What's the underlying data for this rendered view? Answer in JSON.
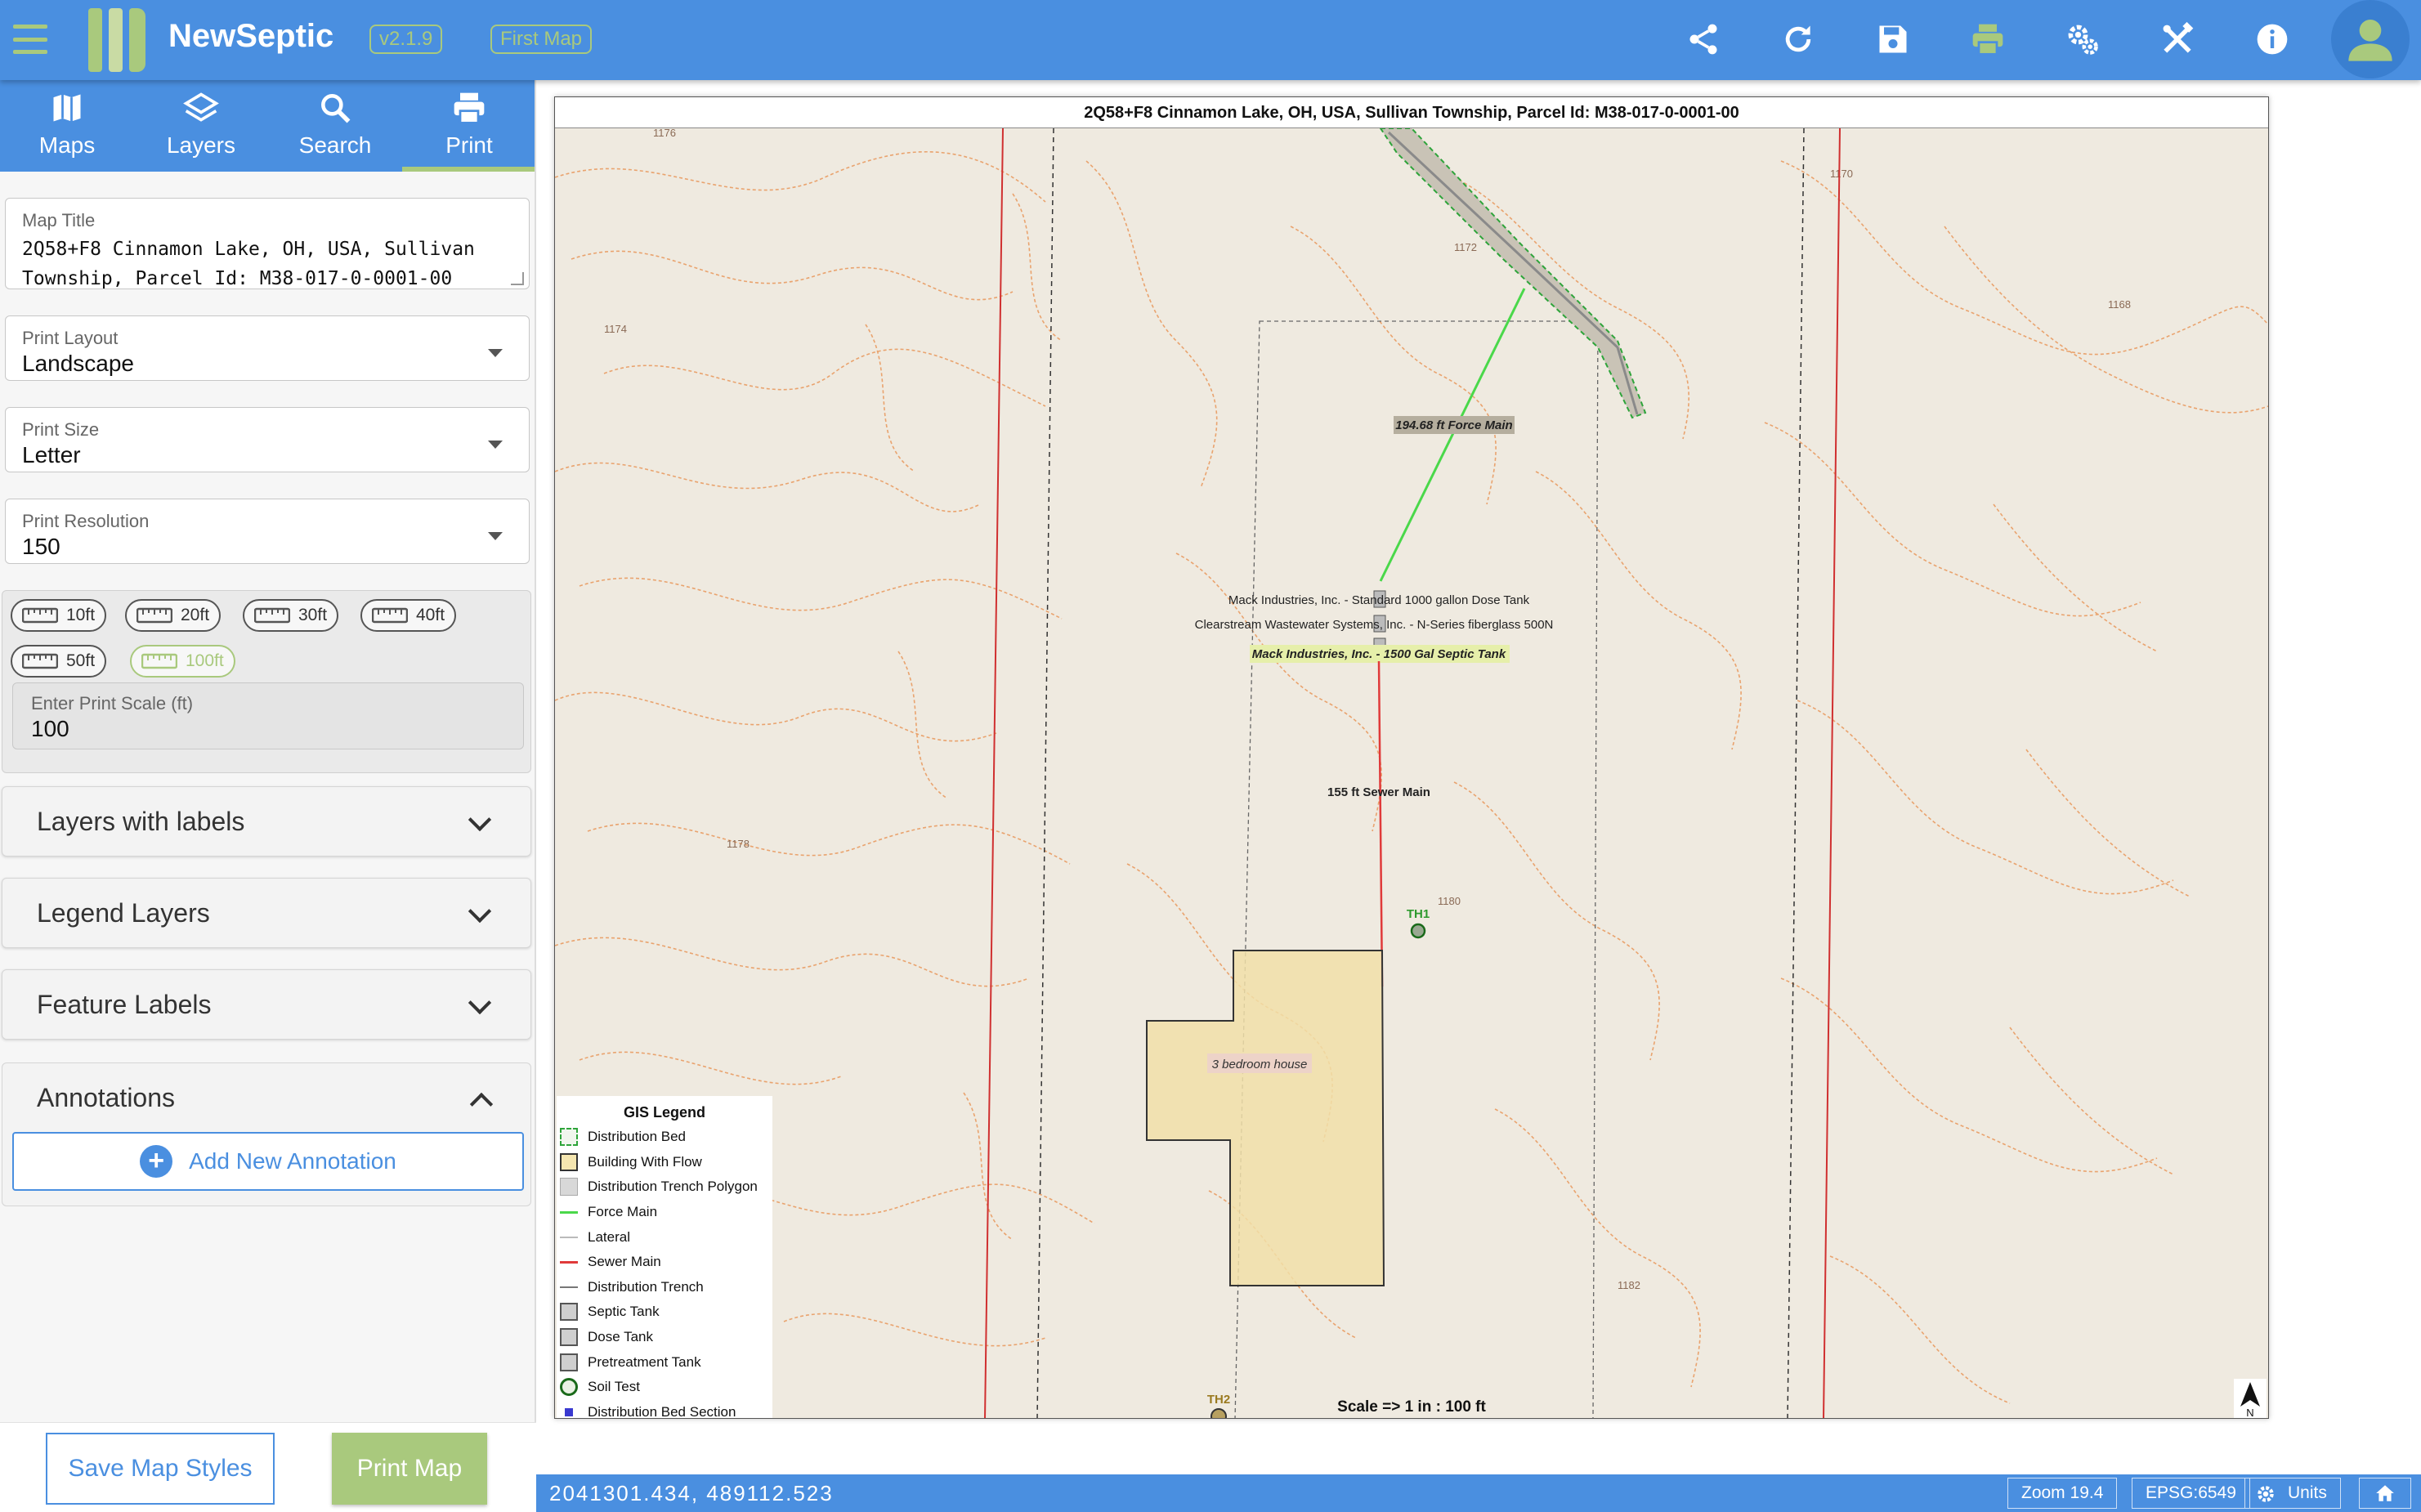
{
  "app": {
    "name": "NewSeptic",
    "version": "v2.1.9",
    "map_name": "First Map"
  },
  "toolbar": {
    "icons": [
      "share-icon",
      "refresh-icon",
      "save-icon",
      "print-icon",
      "settings-icon",
      "tools-icon",
      "info-icon",
      "user-icon"
    ],
    "active_color": "#a9c97d",
    "bar_color": "#4a8fe0"
  },
  "tabs": [
    {
      "label": "Maps",
      "icon": "map-icon"
    },
    {
      "label": "Layers",
      "icon": "layers-icon"
    },
    {
      "label": "Search",
      "icon": "search-icon"
    },
    {
      "label": "Print",
      "icon": "printer-icon",
      "active": true
    }
  ],
  "print": {
    "map_title_label": "Map Title",
    "map_title_value": "2Q58+F8 Cinnamon Lake, OH, USA, Sullivan Township,  Parcel Id: M38-017-0-0001-00",
    "layout_label": "Print Layout",
    "layout_value": "Landscape",
    "size_label": "Print Size",
    "size_value": "Letter",
    "resolution_label": "Print Resolution",
    "resolution_value": "150",
    "scale_chips": [
      "10ft",
      "20ft",
      "30ft",
      "40ft",
      "50ft",
      "100ft"
    ],
    "selected_scale_chip": "100ft",
    "scale_input_label": "Enter Print Scale (ft)",
    "scale_input_value": "100"
  },
  "accordions": {
    "layers_with_labels": "Layers with labels",
    "legend_layers": "Legend Layers",
    "feature_labels": "Feature Labels",
    "annotations": "Annotations",
    "add_annotation": "Add New Annotation"
  },
  "buttons": {
    "save_styles": "Save Map Styles",
    "print_map": "Print Map"
  },
  "map": {
    "title": "2Q58+F8 Cinnamon Lake, OH, USA, Sullivan Township,  Parcel Id: M38-017-0-0001-00",
    "labels": {
      "force_main": "194.68 ft Force Main",
      "dose_tank": "Mack Industries, Inc. - Standard 1000 gallon Dose Tank",
      "pretreatment": "Clearstream Wastewater Systems, Inc. - N-Series fiberglass 500N",
      "septic_tank": "Mack Industries, Inc. - 1500 Gal Septic Tank",
      "sewer_main": "155 ft Sewer Main",
      "th1": "TH1",
      "th2": "TH2",
      "house": "3 bedroom house"
    },
    "contours": [
      "1176",
      "1174",
      "1172",
      "1170",
      "1178",
      "1180",
      "1182",
      "1168"
    ],
    "scale_text": "Scale => 1 in : 100 ft",
    "north": "N"
  },
  "legend": {
    "title": "GIS Legend",
    "items": [
      {
        "label": "Distribution Bed",
        "symbol": "dashed-green-box"
      },
      {
        "label": "Building With Flow",
        "symbol": "yellow-box"
      },
      {
        "label": "Distribution Trench Polygon",
        "symbol": "gray-box"
      },
      {
        "label": "Force Main",
        "symbol": "green-line"
      },
      {
        "label": "Lateral",
        "symbol": "gray-line"
      },
      {
        "label": "Sewer Main",
        "symbol": "red-line"
      },
      {
        "label": "Distribution Trench",
        "symbol": "dark-line"
      },
      {
        "label": "Septic Tank",
        "symbol": "gray-box"
      },
      {
        "label": "Dose Tank",
        "symbol": "gray-box"
      },
      {
        "label": "Pretreatment Tank",
        "symbol": "gray-box"
      },
      {
        "label": "Soil Test",
        "symbol": "green-circle"
      },
      {
        "label": "Distribution Bed Section",
        "symbol": "blue-square"
      }
    ]
  },
  "status": {
    "coords": "2041301.434, 489112.523",
    "zoom": "Zoom 19.4",
    "epsg": "EPSG:6549",
    "units": "Units"
  }
}
